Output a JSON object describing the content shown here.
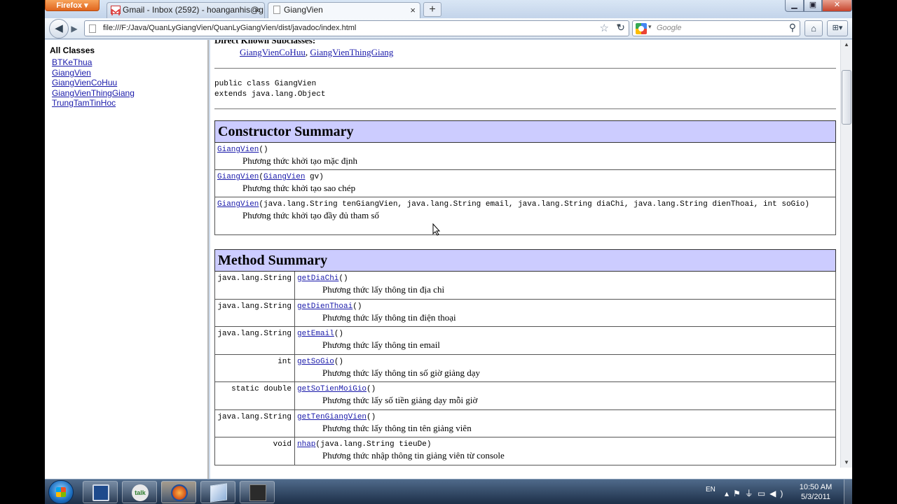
{
  "browser": {
    "app_button": "Firefox",
    "tabs": [
      {
        "title": "Gmail - Inbox (2592) - hoanganhis@g...",
        "icon": "gmail-icon"
      },
      {
        "title": "GiangVien",
        "icon": "page-icon"
      }
    ],
    "new_tab": "+",
    "url": "file:///F:/Java/QuanLyGiangVien/QuanLyGiangVien/dist/javadoc/index.html",
    "search_placeholder": "Google"
  },
  "left_frame": {
    "heading": "All Classes",
    "classes": [
      "BTKeThua",
      "GiangVien",
      "GiangVienCoHuu",
      "GiangVienThingGiang",
      "TrungTamTinHoc"
    ]
  },
  "right_frame": {
    "subclasses_heading": "Direct Known Subclasses:",
    "subclasses": [
      "GiangVienCoHuu",
      "GiangVienThingGiang"
    ],
    "subclass_separator": ", ",
    "declaration_line1": "public class GiangVien",
    "declaration_line2": "extends java.lang.Object",
    "constructor_summary": {
      "title": "Constructor Summary",
      "rows": [
        {
          "name": "GiangVien",
          "sig_pre": "()",
          "param_link": "",
          "sig_post": "",
          "desc": "Phương thức khởi tạo mặc định"
        },
        {
          "name": "GiangVien",
          "sig_pre": "(",
          "param_link": "GiangVien",
          "sig_post": " gv)",
          "desc": "Phương thức khởi tạo sao chép"
        },
        {
          "name": "GiangVien",
          "sig_pre": "(java.lang.String tenGiangVien, java.lang.String email, java.lang.String diaChi, java.lang.String dienThoai, int soGio)",
          "param_link": "",
          "sig_post": "",
          "desc": "Phương thức khởi tạo đầy đủ tham số"
        }
      ]
    },
    "method_summary": {
      "title": "Method Summary",
      "rows": [
        {
          "type": "java.lang.String",
          "name": "getDiaChi",
          "sig": "()",
          "desc": "Phương thức lấy thông tin địa chỉ"
        },
        {
          "type": "java.lang.String",
          "name": "getDienThoai",
          "sig": "()",
          "desc": "Phương thức lấy thông tin điện thoại"
        },
        {
          "type": "java.lang.String",
          "name": "getEmail",
          "sig": "()",
          "desc": "Phương thức lấy thông tin email"
        },
        {
          "type": "int",
          "name": "getSoGio",
          "sig": "()",
          "desc": "Phương thức lấy thông tin số giờ giảng dạy"
        },
        {
          "type": "static double",
          "name": "getSoTienMoiGio",
          "sig": "()",
          "desc": "Phương thức lấy số tiền giảng dạy mỗi giờ"
        },
        {
          "type": "java.lang.String",
          "name": "getTenGiangVien",
          "sig": "()",
          "desc": "Phương thức lấy thông tin tên giảng viên"
        },
        {
          "type": "void",
          "name": "nhap",
          "sig": "(java.lang.String tieuDe)",
          "desc": "Phương thức nhập thông tin giảng viên từ console"
        }
      ]
    }
  },
  "taskbar": {
    "language": "EN",
    "time": "10:50 AM",
    "date": "5/3/2011",
    "apps": [
      "save-app-icon",
      "google-talk-icon",
      "firefox-icon",
      "box-app-icon",
      "media-app-icon"
    ],
    "tb2_text": "talk"
  }
}
